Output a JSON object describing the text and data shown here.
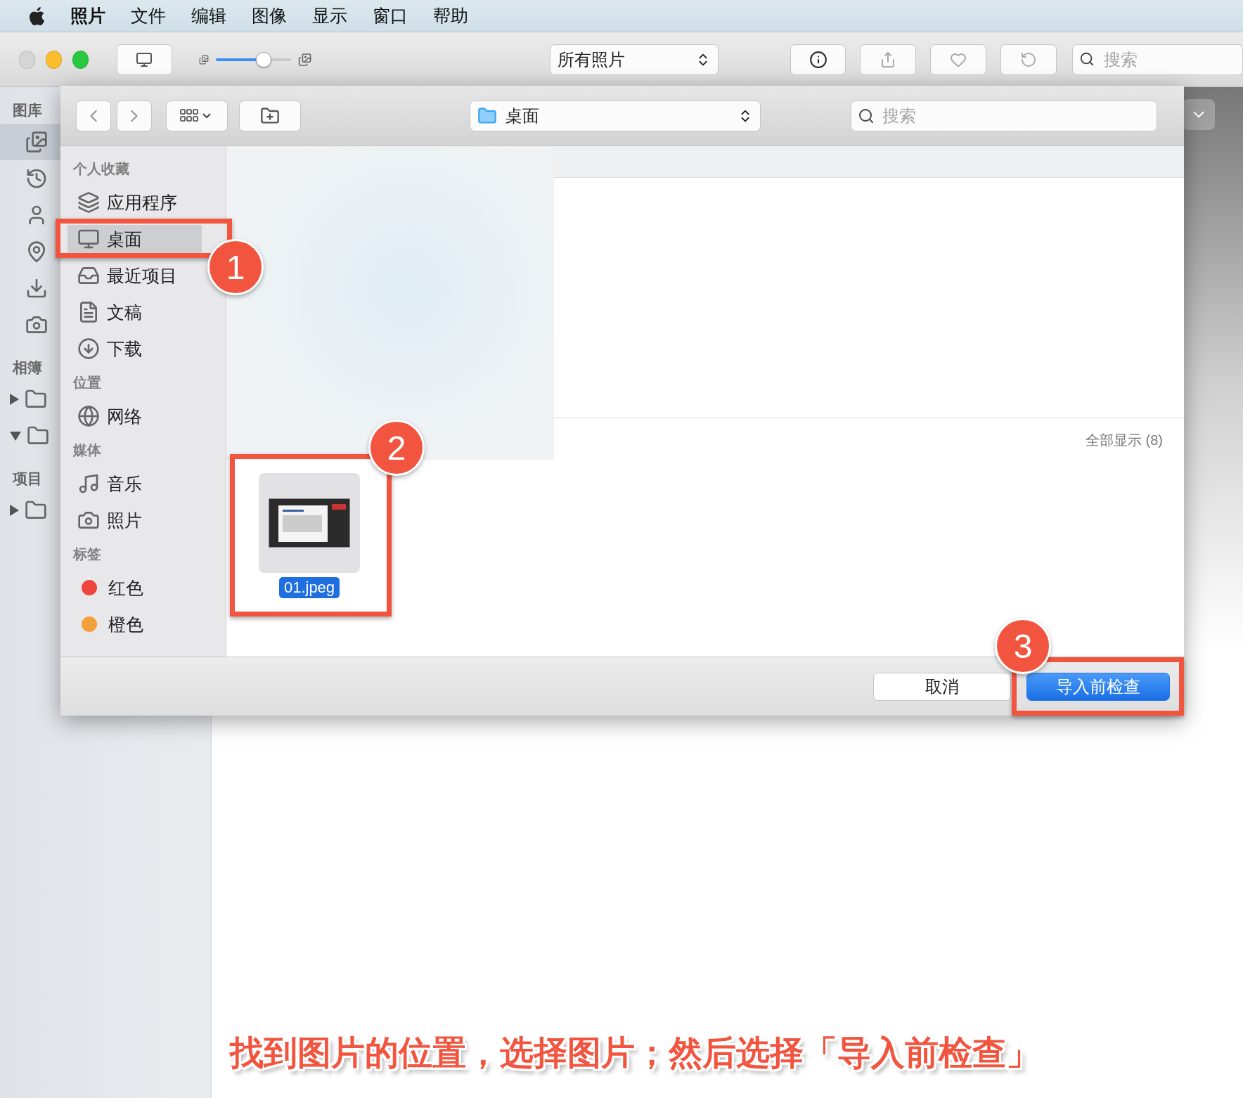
{
  "menu_bar": {
    "items": [
      "照片",
      "文件",
      "编辑",
      "图像",
      "显示",
      "窗口",
      "帮助"
    ]
  },
  "toolbar": {
    "zoom_slider": {
      "level": 0.64
    },
    "view_popup": "所有照片",
    "search": {
      "placeholder": "搜索"
    }
  },
  "sidebar": {
    "library": {
      "heading": "图库",
      "items": [
        {
          "kind": "photos",
          "selected": true
        },
        {
          "kind": "memories",
          "selected": false
        },
        {
          "kind": "people",
          "selected": false
        },
        {
          "kind": "places",
          "selected": false
        },
        {
          "kind": "imports",
          "selected": false
        },
        {
          "kind": "camera",
          "selected": false
        }
      ]
    },
    "albums": {
      "heading": "相簿",
      "items": [
        {
          "expanded": false
        },
        {
          "expanded": true
        }
      ]
    },
    "projects": {
      "heading": "项目",
      "items": [
        {
          "expanded": false
        }
      ]
    }
  },
  "dialog": {
    "location": "桌面",
    "search": {
      "placeholder": "搜索"
    },
    "sidebar": [
      {
        "heading": "个人收藏",
        "items": [
          {
            "label": "应用程序",
            "kind": "apps",
            "selected": false
          },
          {
            "label": "桌面",
            "kind": "desktop",
            "selected": true
          },
          {
            "label": "最近项目",
            "kind": "recents",
            "selected": false
          },
          {
            "label": "文稿",
            "kind": "documents",
            "selected": false
          },
          {
            "label": "下载",
            "kind": "downloads",
            "selected": false
          }
        ]
      },
      {
        "heading": "位置",
        "items": [
          {
            "label": "网络",
            "kind": "network",
            "selected": false
          }
        ]
      },
      {
        "heading": "媒体",
        "items": [
          {
            "label": "音乐",
            "kind": "music",
            "selected": false
          },
          {
            "label": "照片",
            "kind": "photos",
            "selected": false
          }
        ]
      },
      {
        "heading": "标签",
        "items": [
          {
            "label": "红色",
            "kind": "tag",
            "color": "#f0453f",
            "selected": false
          },
          {
            "label": "橙色",
            "kind": "tag",
            "color": "#f5a03a",
            "selected": false
          }
        ]
      }
    ],
    "show_all": "全部显示 (8)",
    "files": [
      {
        "name": "01.jpeg",
        "selected": true
      }
    ],
    "buttons": {
      "cancel": "取消",
      "confirm": "导入前检查"
    }
  },
  "annotations": {
    "steps": [
      "1",
      "2",
      "3"
    ],
    "caption": "找到图片的位置，选择图片；然后选择「导入前检查」"
  }
}
